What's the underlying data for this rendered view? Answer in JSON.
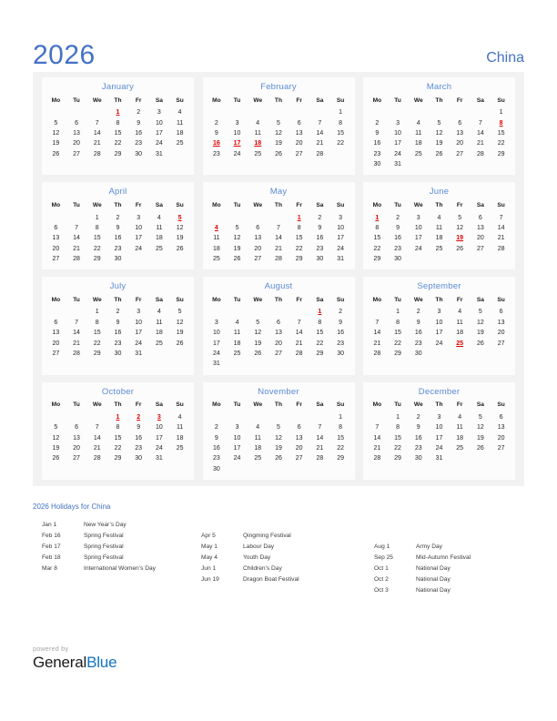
{
  "header": {
    "year": "2026",
    "country": "China"
  },
  "weekday_headers": [
    "Mo",
    "Tu",
    "We",
    "Th",
    "Fr",
    "Sa",
    "Su"
  ],
  "colors": {
    "accent_blue": "#4472c4",
    "month_title_blue": "#5b8bd5",
    "holiday_red": "#e00000",
    "card_bg": "#fcfcfc",
    "grid_bg": "#f2f2f2",
    "brand_blue": "#1173c4"
  },
  "months": [
    {
      "name": "January",
      "weeks": [
        [
          "",
          "",
          "",
          "1",
          "2",
          "3",
          "4"
        ],
        [
          "5",
          "6",
          "7",
          "8",
          "9",
          "10",
          "11"
        ],
        [
          "12",
          "13",
          "14",
          "15",
          "16",
          "17",
          "18"
        ],
        [
          "19",
          "20",
          "21",
          "22",
          "23",
          "24",
          "25"
        ],
        [
          "26",
          "27",
          "28",
          "29",
          "30",
          "31",
          ""
        ]
      ],
      "holidays": [
        "1"
      ]
    },
    {
      "name": "February",
      "weeks": [
        [
          "",
          "",
          "",
          "",
          "",
          "",
          "1"
        ],
        [
          "2",
          "3",
          "4",
          "5",
          "6",
          "7",
          "8"
        ],
        [
          "9",
          "10",
          "11",
          "12",
          "13",
          "14",
          "15"
        ],
        [
          "16",
          "17",
          "18",
          "19",
          "20",
          "21",
          "22"
        ],
        [
          "23",
          "24",
          "25",
          "26",
          "27",
          "28",
          ""
        ]
      ],
      "holidays": [
        "16",
        "17",
        "18"
      ]
    },
    {
      "name": "March",
      "weeks": [
        [
          "",
          "",
          "",
          "",
          "",
          "",
          "1"
        ],
        [
          "2",
          "3",
          "4",
          "5",
          "6",
          "7",
          "8"
        ],
        [
          "9",
          "10",
          "11",
          "12",
          "13",
          "14",
          "15"
        ],
        [
          "16",
          "17",
          "18",
          "19",
          "20",
          "21",
          "22"
        ],
        [
          "23",
          "24",
          "25",
          "26",
          "27",
          "28",
          "29"
        ],
        [
          "30",
          "31",
          "",
          "",
          "",
          "",
          ""
        ]
      ],
      "holidays": [
        "8"
      ]
    },
    {
      "name": "April",
      "weeks": [
        [
          "",
          "",
          "1",
          "2",
          "3",
          "4",
          "5"
        ],
        [
          "6",
          "7",
          "8",
          "9",
          "10",
          "11",
          "12"
        ],
        [
          "13",
          "14",
          "15",
          "16",
          "17",
          "18",
          "19"
        ],
        [
          "20",
          "21",
          "22",
          "23",
          "24",
          "25",
          "26"
        ],
        [
          "27",
          "28",
          "29",
          "30",
          "",
          "",
          ""
        ]
      ],
      "holidays": [
        "5"
      ]
    },
    {
      "name": "May",
      "weeks": [
        [
          "",
          "",
          "",
          "",
          "1",
          "2",
          "3"
        ],
        [
          "4",
          "5",
          "6",
          "7",
          "8",
          "9",
          "10"
        ],
        [
          "11",
          "12",
          "13",
          "14",
          "15",
          "16",
          "17"
        ],
        [
          "18",
          "19",
          "20",
          "21",
          "22",
          "23",
          "24"
        ],
        [
          "25",
          "26",
          "27",
          "28",
          "29",
          "30",
          "31"
        ]
      ],
      "holidays": [
        "1",
        "4"
      ]
    },
    {
      "name": "June",
      "weeks": [
        [
          "1",
          "2",
          "3",
          "4",
          "5",
          "6",
          "7"
        ],
        [
          "8",
          "9",
          "10",
          "11",
          "12",
          "13",
          "14"
        ],
        [
          "15",
          "16",
          "17",
          "18",
          "19",
          "20",
          "21"
        ],
        [
          "22",
          "23",
          "24",
          "25",
          "26",
          "27",
          "28"
        ],
        [
          "29",
          "30",
          "",
          "",
          "",
          "",
          ""
        ]
      ],
      "holidays": [
        "1",
        "19"
      ]
    },
    {
      "name": "July",
      "weeks": [
        [
          "",
          "",
          "1",
          "2",
          "3",
          "4",
          "5"
        ],
        [
          "6",
          "7",
          "8",
          "9",
          "10",
          "11",
          "12"
        ],
        [
          "13",
          "14",
          "15",
          "16",
          "17",
          "18",
          "19"
        ],
        [
          "20",
          "21",
          "22",
          "23",
          "24",
          "25",
          "26"
        ],
        [
          "27",
          "28",
          "29",
          "30",
          "31",
          "",
          ""
        ]
      ],
      "holidays": []
    },
    {
      "name": "August",
      "weeks": [
        [
          "",
          "",
          "",
          "",
          "",
          "1",
          "2"
        ],
        [
          "3",
          "4",
          "5",
          "6",
          "7",
          "8",
          "9"
        ],
        [
          "10",
          "11",
          "12",
          "13",
          "14",
          "15",
          "16"
        ],
        [
          "17",
          "18",
          "19",
          "20",
          "21",
          "22",
          "23"
        ],
        [
          "24",
          "25",
          "26",
          "27",
          "28",
          "29",
          "30"
        ],
        [
          "31",
          "",
          "",
          "",
          "",
          "",
          ""
        ]
      ],
      "holidays": [
        "1"
      ]
    },
    {
      "name": "September",
      "weeks": [
        [
          "",
          "1",
          "2",
          "3",
          "4",
          "5",
          "6"
        ],
        [
          "7",
          "8",
          "9",
          "10",
          "11",
          "12",
          "13"
        ],
        [
          "14",
          "15",
          "16",
          "17",
          "18",
          "19",
          "20"
        ],
        [
          "21",
          "22",
          "23",
          "24",
          "25",
          "26",
          "27"
        ],
        [
          "28",
          "29",
          "30",
          "",
          "",
          "",
          ""
        ]
      ],
      "holidays": [
        "25"
      ]
    },
    {
      "name": "October",
      "weeks": [
        [
          "",
          "",
          "",
          "1",
          "2",
          "3",
          "4"
        ],
        [
          "5",
          "6",
          "7",
          "8",
          "9",
          "10",
          "11"
        ],
        [
          "12",
          "13",
          "14",
          "15",
          "16",
          "17",
          "18"
        ],
        [
          "19",
          "20",
          "21",
          "22",
          "23",
          "24",
          "25"
        ],
        [
          "26",
          "27",
          "28",
          "29",
          "30",
          "31",
          ""
        ]
      ],
      "holidays": [
        "1",
        "2",
        "3"
      ]
    },
    {
      "name": "November",
      "weeks": [
        [
          "",
          "",
          "",
          "",
          "",
          "",
          "1"
        ],
        [
          "2",
          "3",
          "4",
          "5",
          "6",
          "7",
          "8"
        ],
        [
          "9",
          "10",
          "11",
          "12",
          "13",
          "14",
          "15"
        ],
        [
          "16",
          "17",
          "18",
          "19",
          "20",
          "21",
          "22"
        ],
        [
          "23",
          "24",
          "25",
          "26",
          "27",
          "28",
          "29"
        ],
        [
          "30",
          "",
          "",
          "",
          "",
          "",
          ""
        ]
      ],
      "holidays": []
    },
    {
      "name": "December",
      "weeks": [
        [
          "",
          "1",
          "2",
          "3",
          "4",
          "5",
          "6"
        ],
        [
          "7",
          "8",
          "9",
          "10",
          "11",
          "12",
          "13"
        ],
        [
          "14",
          "15",
          "16",
          "17",
          "18",
          "19",
          "20"
        ],
        [
          "21",
          "22",
          "23",
          "24",
          "25",
          "26",
          "27"
        ],
        [
          "28",
          "29",
          "30",
          "31",
          "",
          "",
          ""
        ]
      ],
      "holidays": []
    }
  ],
  "holidays_section": {
    "heading": "2026 Holidays for China",
    "columns": [
      [
        {
          "date": "Jan 1",
          "name": "New Year’s Day"
        },
        {
          "date": "Feb 16",
          "name": "Spring Festival"
        },
        {
          "date": "Feb 17",
          "name": "Spring Festival"
        },
        {
          "date": "Feb 18",
          "name": "Spring Festival"
        },
        {
          "date": "Mar 8",
          "name": "International Women’s Day"
        }
      ],
      [
        {
          "date": "Apr 5",
          "name": "Qingming Festival"
        },
        {
          "date": "May 1",
          "name": "Labour Day"
        },
        {
          "date": "May 4",
          "name": "Youth Day"
        },
        {
          "date": "Jun 1",
          "name": "Children’s Day"
        },
        {
          "date": "Jun 19",
          "name": "Dragon Boat Festival"
        }
      ],
      [
        {
          "date": "Aug 1",
          "name": "Army Day"
        },
        {
          "date": "Sep 25",
          "name": "Mid-Autumn Festival"
        },
        {
          "date": "Oct 1",
          "name": "National Day"
        },
        {
          "date": "Oct 2",
          "name": "National Day"
        },
        {
          "date": "Oct 3",
          "name": "National Day"
        }
      ]
    ],
    "column_offsets": [
      0,
      1,
      2
    ]
  },
  "footer": {
    "powered_by": "powered by",
    "brand_first": "General",
    "brand_second": "Blue"
  }
}
